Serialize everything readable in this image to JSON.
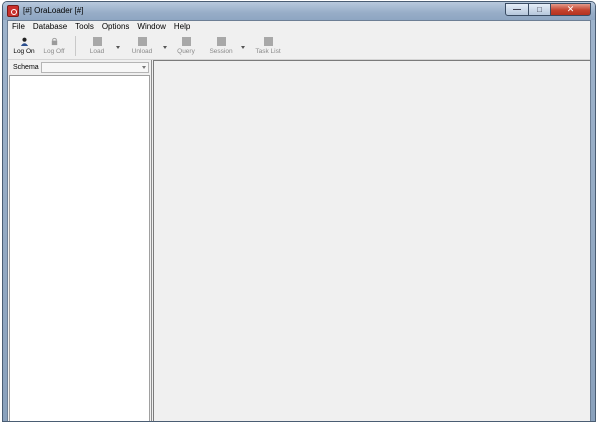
{
  "window": {
    "title": "[#] OraLoader [#]",
    "caption_buttons": {
      "minimize": "—",
      "maximize": "□",
      "close": "✕"
    }
  },
  "menu": [
    "File",
    "Database",
    "Tools",
    "Options",
    "Window",
    "Help"
  ],
  "toolbar": {
    "log_on": "Log On",
    "log_off": "Log Off",
    "load": "Load",
    "unload": "Unload",
    "query": "Query",
    "session": "Session",
    "task_list": "Task List"
  },
  "schema": {
    "label": "Schema",
    "value": ""
  },
  "icons": {
    "log_on": "user-icon",
    "log_off": "lock-icon",
    "load": "database-icon",
    "unload": "database-icon",
    "query": "query-icon",
    "session": "session-icon",
    "task_list": "task-list-icon"
  }
}
